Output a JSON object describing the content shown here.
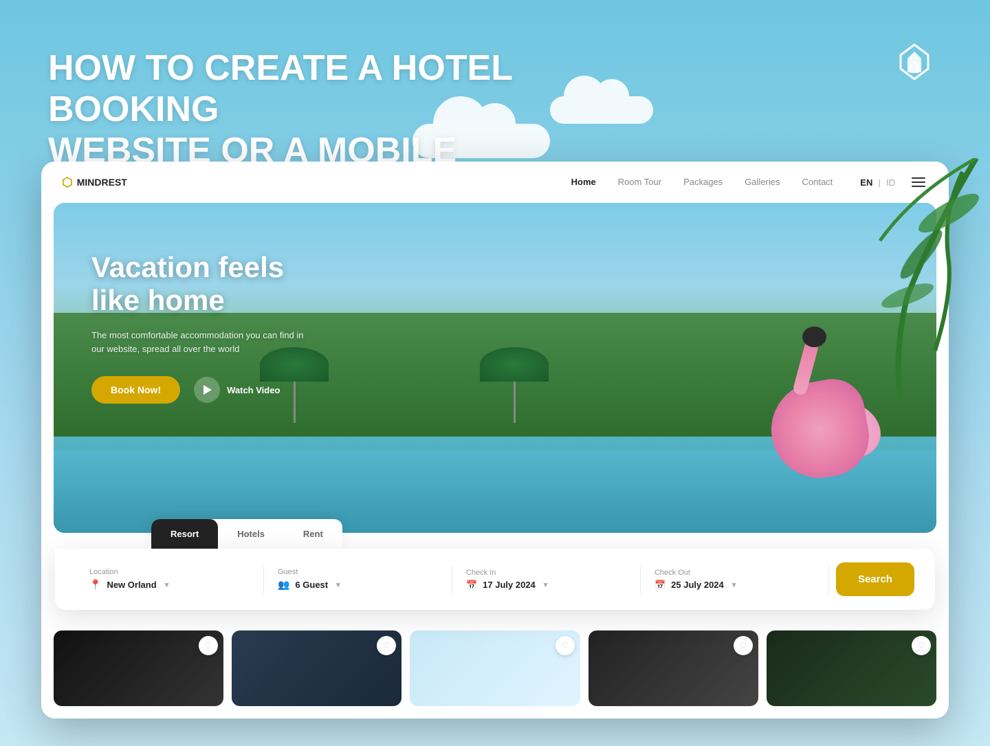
{
  "meta": {
    "title": "How to Create a Hotel Booking Website or a Mobile App"
  },
  "headline": {
    "line1": "HOW TO CREATE A HOTEL BOOKING",
    "line2": "WEBSITE OR A MOBILE APP"
  },
  "navbar": {
    "logo_text": "MINDREST",
    "logo_brand": "MIND",
    "logo_rest": "REST",
    "links": [
      {
        "label": "Home",
        "active": true
      },
      {
        "label": "Room Tour",
        "active": false
      },
      {
        "label": "Packages",
        "active": false
      },
      {
        "label": "Galleries",
        "active": false
      },
      {
        "label": "Contact",
        "active": false
      }
    ],
    "lang_en": "EN",
    "lang_sep": "|",
    "lang_id": "ID",
    "menu_icon": "☰"
  },
  "hero": {
    "title_line1": "Vacation feels",
    "title_line2": "like home",
    "subtitle": "The most comfortable accommodation you can find in our website, spread all over the world",
    "book_button": "Book Now!",
    "watch_button": "Watch Video"
  },
  "booking": {
    "tabs": [
      {
        "label": "Resort",
        "active": true
      },
      {
        "label": "Hotels",
        "active": false
      },
      {
        "label": "Rent",
        "active": false
      }
    ],
    "fields": {
      "location": {
        "label": "Location",
        "value": "New Orland",
        "icon": "📍"
      },
      "guest": {
        "label": "Guest",
        "value": "6 Guest",
        "icon": "👥"
      },
      "checkin": {
        "label": "Check In",
        "value": "17 July 2024",
        "icon": "📅"
      },
      "checkout": {
        "label": "Check Out",
        "value": "25 July 2024",
        "icon": "📅"
      }
    },
    "search_button": "Search"
  },
  "cards": [
    {
      "id": 1,
      "color": "#1a1a1a"
    },
    {
      "id": 2,
      "color": "#2a3a4a"
    },
    {
      "id": 3,
      "color": "#b8d8e8"
    },
    {
      "id": 4,
      "color": "#2a2a2a"
    },
    {
      "id": 5,
      "color": "#1a2a1a"
    }
  ]
}
